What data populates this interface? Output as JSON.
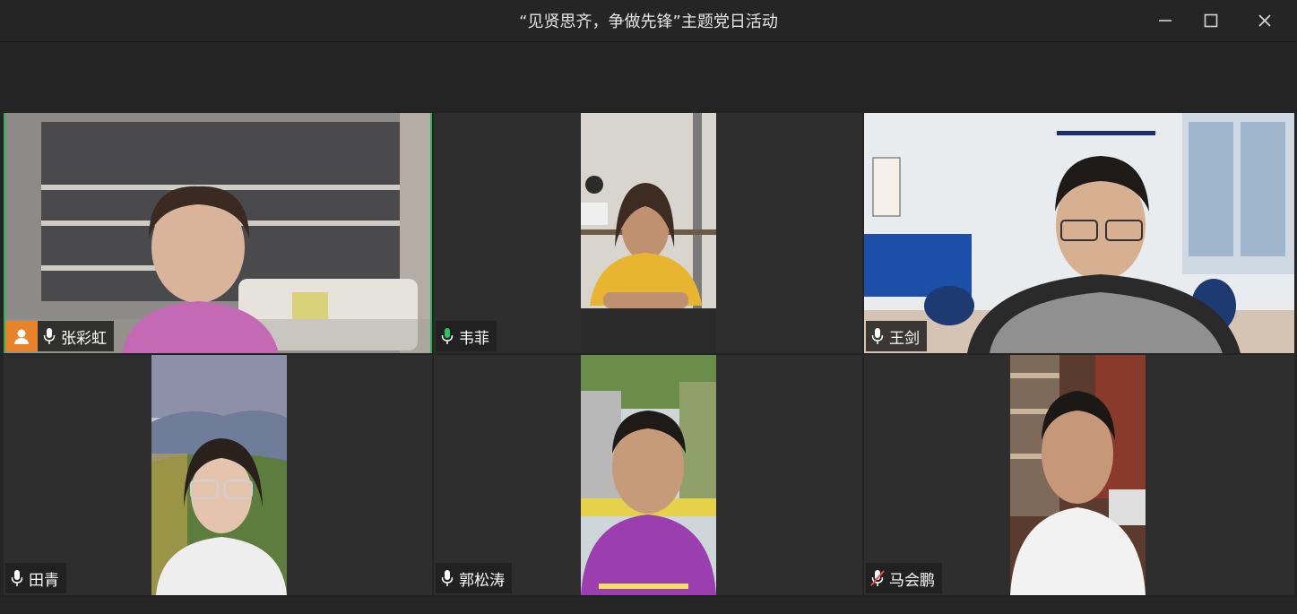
{
  "window": {
    "title": "“见贤思齐，争做先锋”主题党日活动",
    "controls": [
      "minimize",
      "maximize",
      "close"
    ]
  },
  "participants": [
    {
      "name": "张彩虹",
      "host": true,
      "mic": "on",
      "speaking": true,
      "bg": "#9a9590"
    },
    {
      "name": "韦菲",
      "host": false,
      "mic": "active",
      "speaking": false,
      "bg": "#b9a98c"
    },
    {
      "name": "王剑",
      "host": false,
      "mic": "on",
      "speaking": false,
      "bg": "#d9dde2"
    },
    {
      "name": "田青",
      "host": false,
      "mic": "on",
      "speaking": false,
      "bg": "#7f9a6e"
    },
    {
      "name": "郭松涛",
      "host": false,
      "mic": "on",
      "speaking": false,
      "bg": "#8e8a8a"
    },
    {
      "name": "马会鹏",
      "host": false,
      "mic": "muted",
      "speaking": false,
      "bg": "#6d5a4e"
    }
  ],
  "colors": {
    "host_badge": "#e8832a",
    "active_border": "#27b35a",
    "mic_active": "#2fc35a",
    "mic_muted": "#e24b4b"
  }
}
